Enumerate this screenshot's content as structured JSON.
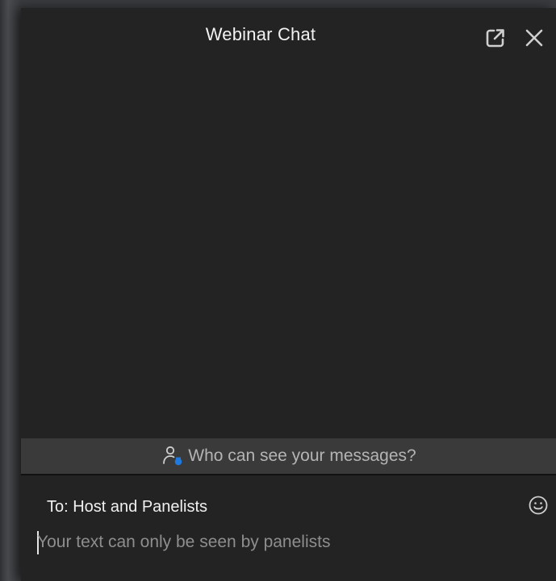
{
  "window": {
    "title": "Webinar Chat"
  },
  "visibility": {
    "label": "Who can see your messages?"
  },
  "composer": {
    "recipient_label": "To: Host and Panelists",
    "placeholder": "Your text can only be seen by panelists",
    "value": ""
  },
  "icons": {
    "popout": "popout-icon",
    "close": "close-icon",
    "visibility": "person-shield-icon",
    "emoji": "emoji-icon"
  },
  "colors": {
    "background": "#232323",
    "visibility_bar": "#3a3a3a",
    "accent_blue": "#1f7ae0",
    "text_primary": "#f2f2f2",
    "text_secondary": "#b4b4b4",
    "placeholder": "#8e8e8e"
  }
}
